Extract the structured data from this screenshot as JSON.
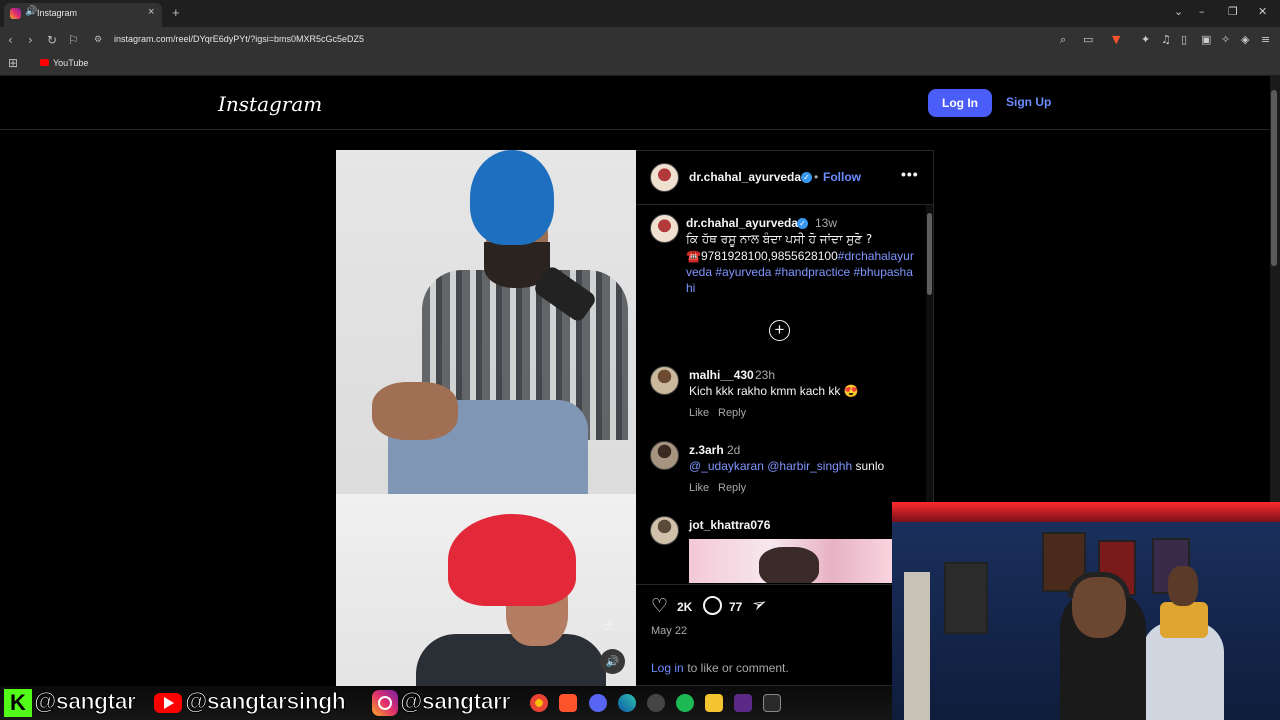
{
  "browser": {
    "tab_title": "Instagram",
    "url": "instagram.com/reel/DYqrE6dyPYt/?igsi=bms0MXR5cGc5eDZ5",
    "bookmark_label": "YouTube"
  },
  "header": {
    "logo": "Instagram",
    "login_label": "Log In",
    "signup_label": "Sign Up"
  },
  "post": {
    "owner": "dr.chahal_ayurveda",
    "follow_label": "Follow",
    "caption": {
      "author": "dr.chahal_ayurveda",
      "time": "13w",
      "line1": "ਕਿ ਹੱਥ ਰਸੂ ਨਾਲ ਬੰਦਾ ਪਸੀ ਹੋ ਜਾਂਦਾ ਸੁਣੋ ?",
      "phone": "☎️9781928100,9855628100",
      "tag1": "#drchahalayurveda",
      "tag2": "#ayurveda",
      "tag3": "#handpractice",
      "tag4": "#bhupashahi"
    },
    "comments": [
      {
        "user": "malhi__430",
        "time": "23h",
        "text": "Kich kkk rakho kmm kach kk 😍",
        "like": "Like",
        "reply": "Reply"
      },
      {
        "user": "z.3arh",
        "time": "2d",
        "mention1": "@_udaykaran",
        "mention2": "@harbir_singhh",
        "text": "sunlo",
        "like": "Like",
        "reply": "Reply"
      },
      {
        "user": "jot_khattra076"
      }
    ],
    "likes": "2K",
    "comments_count": "77",
    "date": "May 22",
    "login_link": "Log in",
    "login_rest": "to like or comment."
  },
  "overlay": {
    "kick": "@sangtar",
    "youtube": "@sangtarsingh",
    "instagram": "@sangtarr"
  },
  "colors": {
    "accent": "#4a5df9",
    "link": "#6c8cff",
    "hashtag": "#7e96ff"
  }
}
